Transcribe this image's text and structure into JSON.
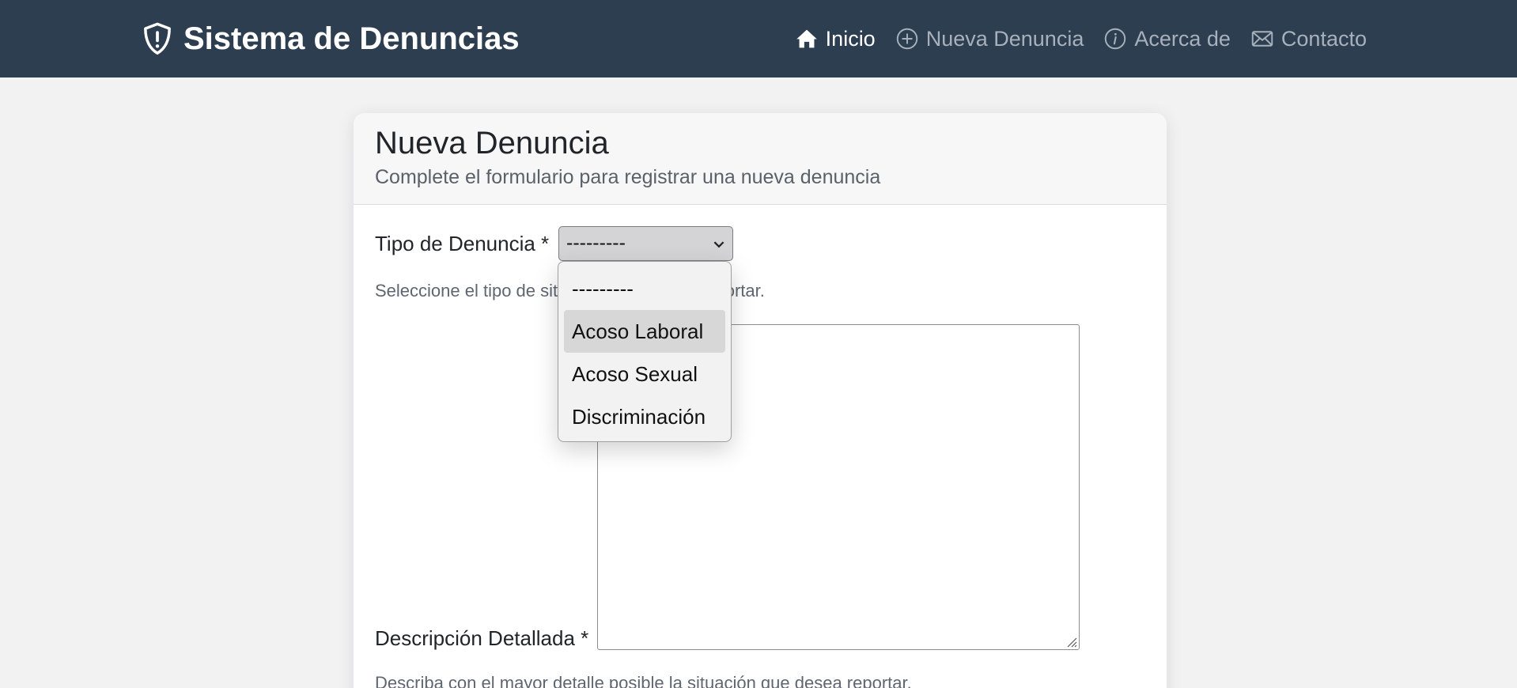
{
  "navbar": {
    "brand": "Sistema de Denuncias",
    "items": [
      {
        "label": "Inicio",
        "icon": "house-icon",
        "active": true
      },
      {
        "label": "Nueva Denuncia",
        "icon": "plus-circle-icon",
        "active": false
      },
      {
        "label": "Acerca de",
        "icon": "info-circle-icon",
        "active": false
      },
      {
        "label": "Contacto",
        "icon": "envelope-icon",
        "active": false
      }
    ]
  },
  "card": {
    "title": "Nueva Denuncia",
    "subtitle": "Complete el formulario para registrar una nueva denuncia"
  },
  "form": {
    "tipo_label": "Tipo de Denuncia *",
    "tipo_selected": "---------",
    "tipo_help": "Seleccione el tipo de situación que desea reportar.",
    "tipo_options": [
      "---------",
      "Acoso Laboral",
      "Acoso Sexual",
      "Discriminación"
    ],
    "tipo_highlighted": "Acoso Laboral",
    "descripcion_label": "Descripción Detallada *",
    "descripcion_value": "",
    "descripcion_help": "Describa con el mayor detalle posible la situación que desea reportar."
  },
  "colors": {
    "navbar_bg": "#2c3e50",
    "page_bg": "#f2f2f3",
    "nav_inactive": "#a8b1bb",
    "nav_active": "#ffffff"
  }
}
